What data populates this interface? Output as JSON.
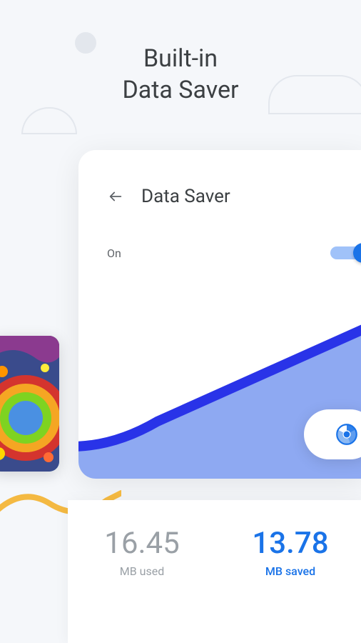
{
  "hero": {
    "line1": "Built-in",
    "line2": "Data Saver"
  },
  "card": {
    "title": "Data Saver",
    "toggle": {
      "label": "On",
      "enabled": true
    }
  },
  "stats": {
    "used": {
      "value": "16.45",
      "label": "MB used"
    },
    "saved": {
      "value": "13.78",
      "label": "MB saved"
    }
  },
  "icons": {
    "back": "back-arrow",
    "chrome": "chrome-icon"
  }
}
